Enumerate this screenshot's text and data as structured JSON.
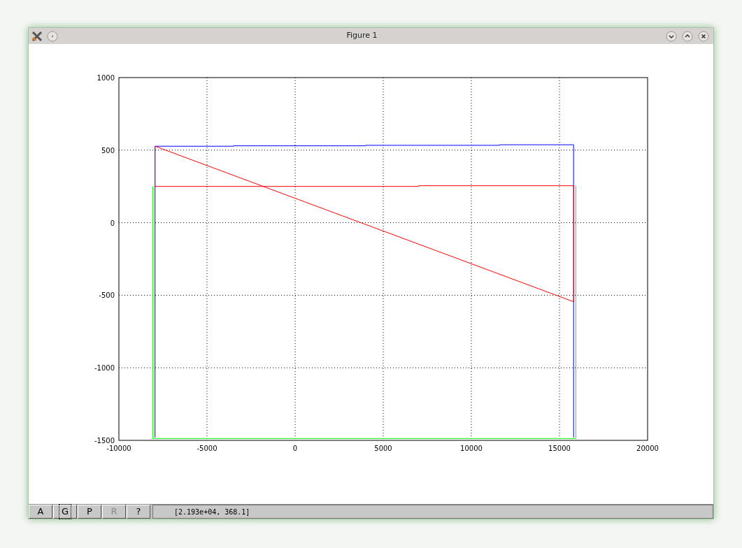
{
  "window": {
    "title": "Figure 1"
  },
  "figure": {
    "chart_data": {
      "type": "line",
      "grid": true,
      "xlim": [
        -10000,
        20000
      ],
      "ylim": [
        -1500,
        1000
      ],
      "xticks": [
        -10000,
        -5000,
        0,
        5000,
        10000,
        15000,
        20000
      ],
      "yticks": [
        -1500,
        -1000,
        -500,
        0,
        500,
        1000
      ],
      "series": [
        {
          "color": "#00ff00",
          "x": [
            -8080,
            -8080,
            15930,
            15930
          ],
          "values": [
            250,
            -1487,
            -1487,
            255
          ]
        },
        {
          "color": "#0000ff",
          "x": [
            -7950,
            -7950,
            -3500,
            -3500,
            4000,
            4000,
            11600,
            11600,
            15800,
            15800
          ],
          "values": [
            -1480,
            527,
            527,
            530,
            530,
            533,
            533,
            537,
            537,
            -1480
          ]
        },
        {
          "color": "#ff0000",
          "x": [
            -7950,
            -7950,
            7000,
            7000,
            15800
          ],
          "values": [
            527,
            250,
            250,
            255,
            255
          ]
        },
        {
          "color": "#ff0000",
          "x": [
            -7950,
            15800,
            15800
          ],
          "values": [
            527,
            -545,
            255
          ]
        }
      ]
    }
  },
  "toolbar": {
    "buttons": [
      {
        "label": "A",
        "selected": false,
        "disabled": false
      },
      {
        "label": "G",
        "selected": true,
        "disabled": false
      },
      {
        "label": "P",
        "selected": false,
        "disabled": false
      },
      {
        "label": "R",
        "selected": false,
        "disabled": true
      },
      {
        "label": "?",
        "selected": false,
        "disabled": false
      }
    ],
    "status": "[2.193e+04, 368.1]"
  }
}
